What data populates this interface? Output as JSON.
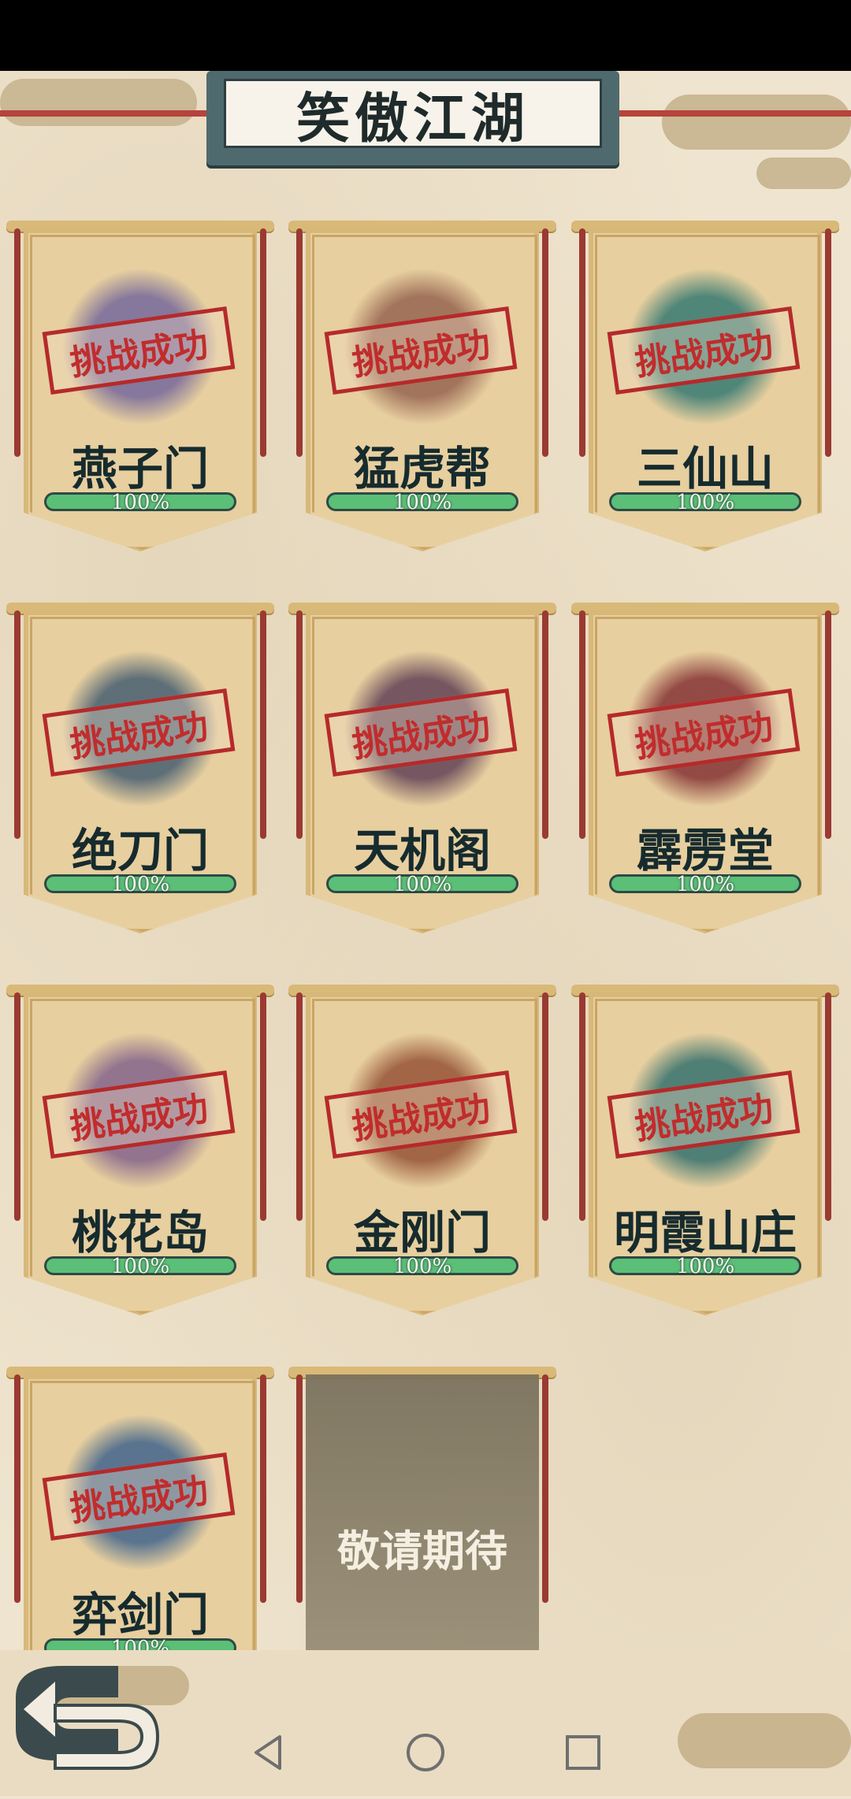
{
  "title": "笑傲江湖",
  "stamp_label": "挑战成功",
  "sects": [
    {
      "name": "燕子门",
      "progress": "100%",
      "emblem_color": "#7b6d9c"
    },
    {
      "name": "猛虎帮",
      "progress": "100%",
      "emblem_color": "#9b6a55"
    },
    {
      "name": "三仙山",
      "progress": "100%",
      "emblem_color": "#3f7e74"
    },
    {
      "name": "绝刀门",
      "progress": "100%",
      "emblem_color": "#4f6474"
    },
    {
      "name": "天机阁",
      "progress": "100%",
      "emblem_color": "#6a4a5a"
    },
    {
      "name": "霹雳堂",
      "progress": "100%",
      "emblem_color": "#8a3b3b"
    },
    {
      "name": "桃花岛",
      "progress": "100%",
      "emblem_color": "#8a6a8c"
    },
    {
      "name": "金刚门",
      "progress": "100%",
      "emblem_color": "#9a5a3c"
    },
    {
      "name": "明霞山庄",
      "progress": "100%",
      "emblem_color": "#3f7670"
    },
    {
      "name": "弈剑门",
      "progress": "100%",
      "emblem_color": "#4a6a8e"
    }
  ],
  "coming_soon": "敬请期待",
  "colors": {
    "progress_green": "#5bbf77",
    "stamp_red": "#c12c2c"
  }
}
